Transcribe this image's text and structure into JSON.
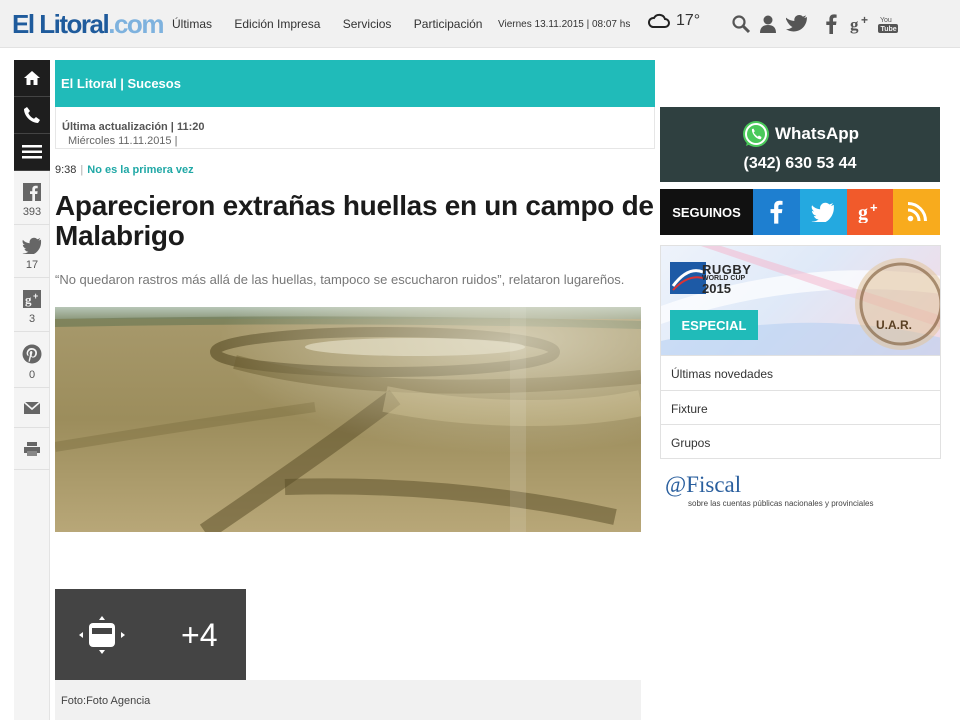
{
  "header": {
    "logo_main": "El Litoral",
    "logo_suffix": ".com",
    "nav": [
      "Últimas",
      "Edición Impresa",
      "Servicios",
      "Participación"
    ],
    "date": "Viernes 13.11.2015 | 08:07 hs",
    "temperature": "17°",
    "icons": [
      "cloud-icon",
      "search-icon",
      "user-icon",
      "twitter-icon",
      "facebook-icon",
      "google-plus-icon",
      "youtube-icon"
    ],
    "brand_color": "#1f5b9c"
  },
  "rail": {
    "icons": [
      "home-icon",
      "phone-icon",
      "menu-icon"
    ],
    "shares": [
      {
        "icon": "facebook-icon",
        "count": "393"
      },
      {
        "icon": "twitter-icon",
        "count": "17"
      },
      {
        "icon": "google-plus-icon",
        "count": "3"
      },
      {
        "icon": "pinterest-icon",
        "count": "0"
      }
    ],
    "extra_icons": [
      "mail-icon",
      "print-icon"
    ]
  },
  "article": {
    "section": "El Litoral | Sucesos",
    "date": "Miércoles 11.11.2015 |",
    "updated_label": "Última actualización |",
    "updated_time": "11:20",
    "time": "9:38",
    "kicker_sep": "|",
    "topic": "No es la primera vez",
    "headline": "Aparecieron extrañas huellas en un campo de Malabrigo",
    "lead": "“No quedaron rastros más allá de las huellas, tampoco se escucharon ruidos”, relataron lugareños.",
    "gallery_count": "+4",
    "caption": "Foto:Foto Agencia",
    "accent_color": "#20bbb9"
  },
  "sidebar": {
    "whatsapp_name": "WhatsApp",
    "whatsapp_phone": "(342) 630 53 44",
    "follow_label": "SEGUINOS",
    "follow_buttons": [
      {
        "icon": "facebook-icon",
        "color": "#1e7fd0"
      },
      {
        "icon": "twitter-icon",
        "color": "#24a9e0"
      },
      {
        "icon": "google-plus-icon",
        "color": "#f15a2b"
      },
      {
        "icon": "rss-icon",
        "color": "#f8ab1d"
      }
    ],
    "rugby_title": "RUGBY",
    "rugby_sub": "WORLD CUP",
    "rugby_year": "2015",
    "rugby_badge": "U.A.R.",
    "especial": "ESPECIAL",
    "rugby_links": [
      "Últimas novedades",
      "Fixture",
      "Grupos"
    ],
    "fiscal_title": "@Fiscal",
    "fiscal_sub": "sobre las cuentas públicas nacionales y provinciales"
  }
}
